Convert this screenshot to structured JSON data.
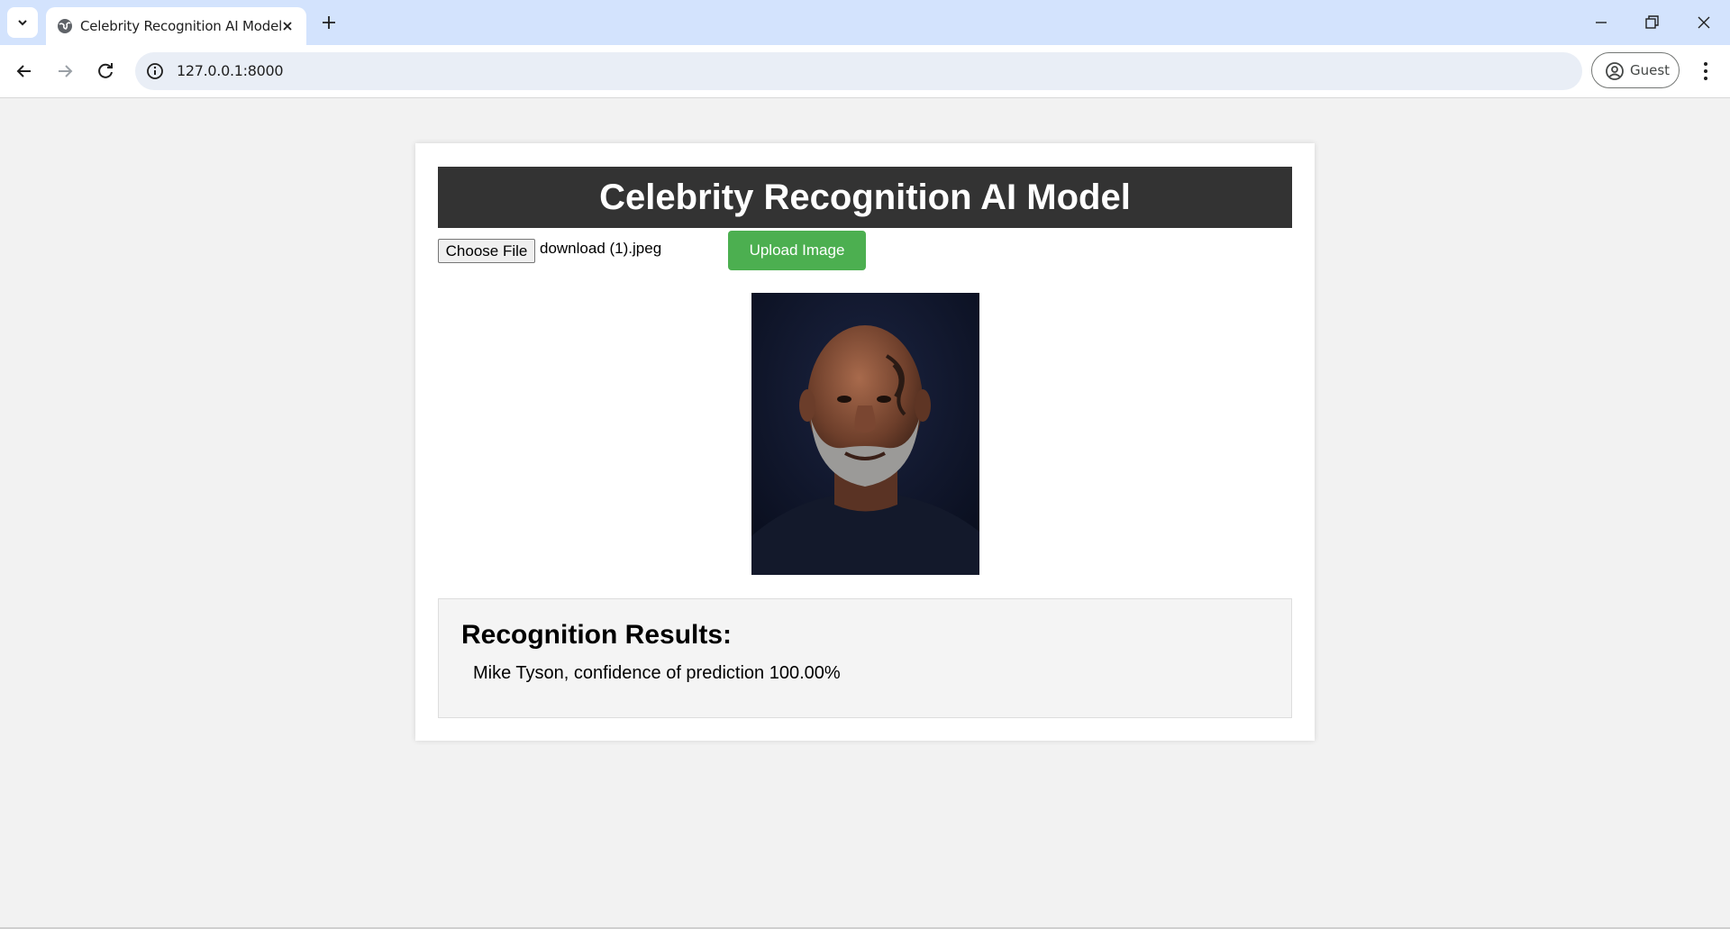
{
  "browser": {
    "tab_title": "Celebrity Recognition AI Model",
    "url": "127.0.0.1:8000",
    "profile_label": "Guest"
  },
  "page": {
    "header_title": "Celebrity Recognition AI Model",
    "choose_file_label": "Choose File",
    "selected_file": "download (1).jpeg",
    "upload_button_label": "Upload Image",
    "results_heading": "Recognition Results:",
    "results": [
      "Mike Tyson, confidence of prediction 100.00%"
    ]
  },
  "colors": {
    "header_bg": "#333333",
    "upload_button": "#4caf50",
    "page_bg": "#f2f2f2",
    "results_bg": "#f4f4f4"
  }
}
